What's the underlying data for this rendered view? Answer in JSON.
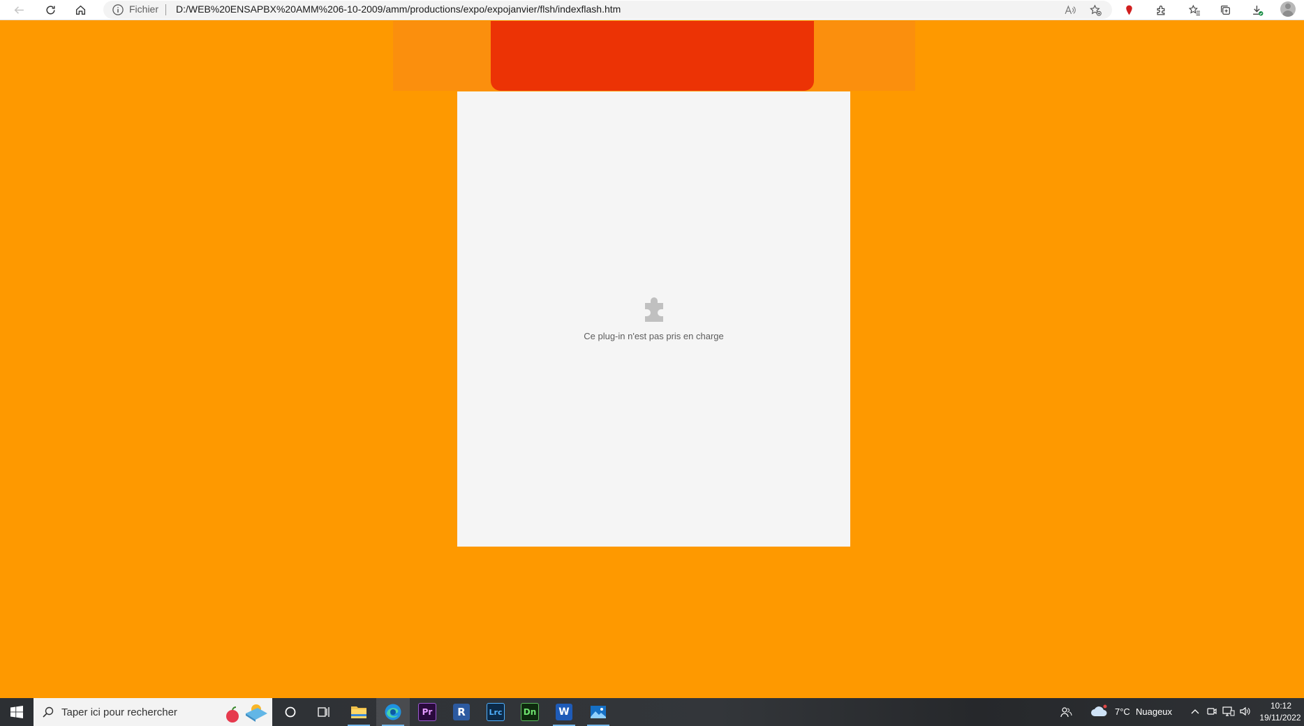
{
  "browser": {
    "site_info_label": "Fichier",
    "url": "D:/WEB%20ENSAPBX%20AMM%206-10-2009/amm/productions/expo/expojanvier/flsh/indexflash.htm",
    "icons": [
      "back-icon",
      "refresh-icon",
      "home-icon",
      "info-icon",
      "read-aloud-icon",
      "add-favorite-icon",
      "pin-icon",
      "extensions-icon",
      "favorites-icon",
      "collections-icon",
      "downloads-icon",
      "profile-icon"
    ]
  },
  "page": {
    "background_color": "#fe9900",
    "header_color": "#ec3305",
    "plugin_message": "Ce plug-in n'est pas pris en charge"
  },
  "taskbar": {
    "search_placeholder": "Taper ici pour rechercher",
    "apps": [
      "file-explorer",
      "edge",
      "premiere-pro",
      "revit",
      "lightroom-classic",
      "dimension",
      "word",
      "photos"
    ],
    "premiere_label": "Pr",
    "revit_label": "R",
    "lightroom_label": "Lrc",
    "dimension_label": "Dn",
    "word_label": "W",
    "weather": {
      "temp": "7°C",
      "condition": "Nuageux"
    },
    "time": "10:12",
    "date": "19/11/2022"
  }
}
